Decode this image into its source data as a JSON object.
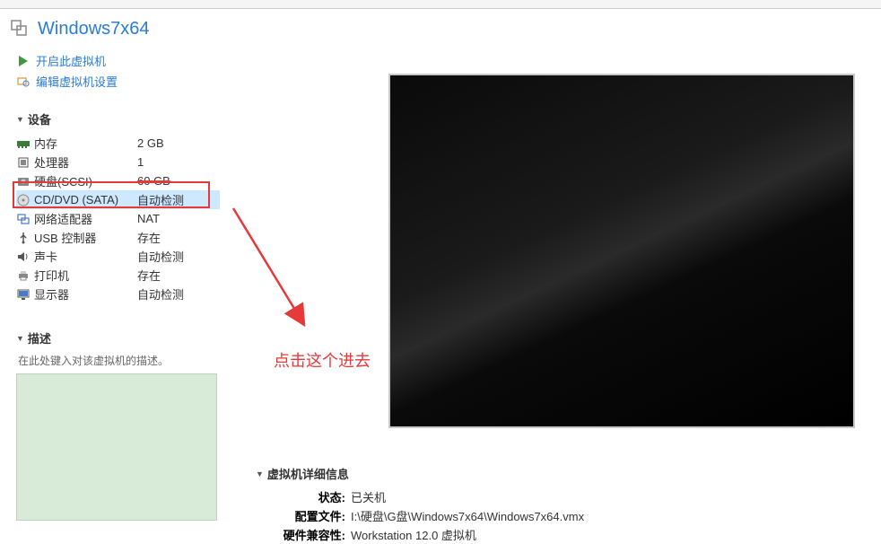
{
  "header": {
    "title": "Windows7x64"
  },
  "actions": {
    "start": "开启此虚拟机",
    "edit": "编辑虚拟机设置"
  },
  "sections": {
    "devices": "设备",
    "description": "描述",
    "details": "虚拟机详细信息"
  },
  "devices": [
    {
      "name": "内存",
      "value": "2 GB"
    },
    {
      "name": "处理器",
      "value": "1"
    },
    {
      "name": "硬盘(SCSI)",
      "value": "60 GB"
    },
    {
      "name": "CD/DVD (SATA)",
      "value": "自动检测"
    },
    {
      "name": "网络适配器",
      "value": "NAT"
    },
    {
      "name": "USB 控制器",
      "value": "存在"
    },
    {
      "name": "声卡",
      "value": "自动检测"
    },
    {
      "name": "打印机",
      "value": "存在"
    },
    {
      "name": "显示器",
      "value": "自动检测"
    }
  ],
  "description": {
    "placeholder": "在此处键入对该虚拟机的描述。"
  },
  "annotation": "点击这个进去",
  "details": {
    "status_label": "状态:",
    "status_value": "已关机",
    "config_label": "配置文件:",
    "config_value": "I:\\硬盘\\G盘\\Windows7x64\\Windows7x64.vmx",
    "compat_label": "硬件兼容性:",
    "compat_value": "Workstation 12.0 虚拟机"
  }
}
